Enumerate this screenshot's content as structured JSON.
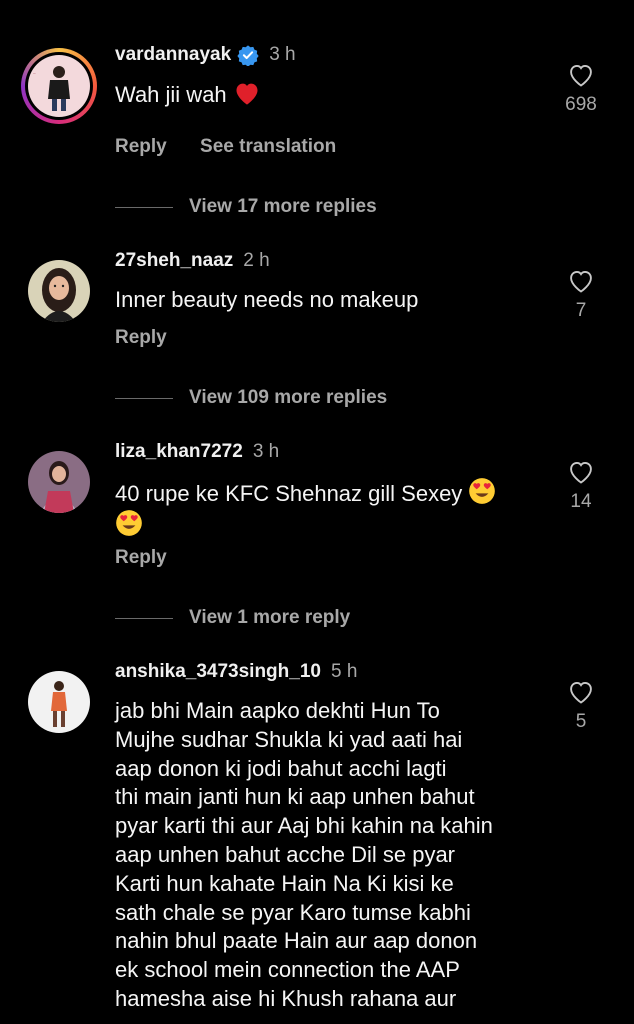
{
  "comments": [
    {
      "username": "vardannayak",
      "time": "3 h",
      "verified": true,
      "text": "Wah jii wah",
      "emoji": "heart",
      "likes": "698",
      "reply_label": "Reply",
      "translate_label": "See translation",
      "view_more": "View 17 more replies"
    },
    {
      "username": "27sheh_naaz",
      "time": "2 h",
      "text": "Inner beauty needs no makeup",
      "likes": "7",
      "reply_label": "Reply",
      "view_more": "View 109 more replies"
    },
    {
      "username": "liza_khan7272",
      "time": "3 h",
      "text_lines": [
        "40 rupe ke KFC Shehnaz gill Sexey"
      ],
      "emoji": "heart-eyes",
      "likes": "14",
      "reply_label": "Reply",
      "view_more": "View 1 more reply"
    },
    {
      "username": "anshika_3473singh_10",
      "time": "5 h",
      "text_lines": [
        "jab bhi Main aapko dekhti Hun To",
        "Mujhe sudhar Shukla ki yad aati hai",
        "aap donon ki jodi bahut acchi lagti",
        "thi main janti hun ki aap unhen bahut",
        "pyar karti thi aur Aaj bhi kahin na kahin",
        "aap unhen bahut acche Dil se pyar",
        "Karti hun kahate Hain Na Ki kisi ke",
        "sath chale se pyar Karo tumse kabhi",
        "nahin bhul paate Hain aur aap donon",
        "ek school mein connection the AAP",
        "hamesha aise hi Khush rahana aur"
      ],
      "likes": "5"
    }
  ]
}
